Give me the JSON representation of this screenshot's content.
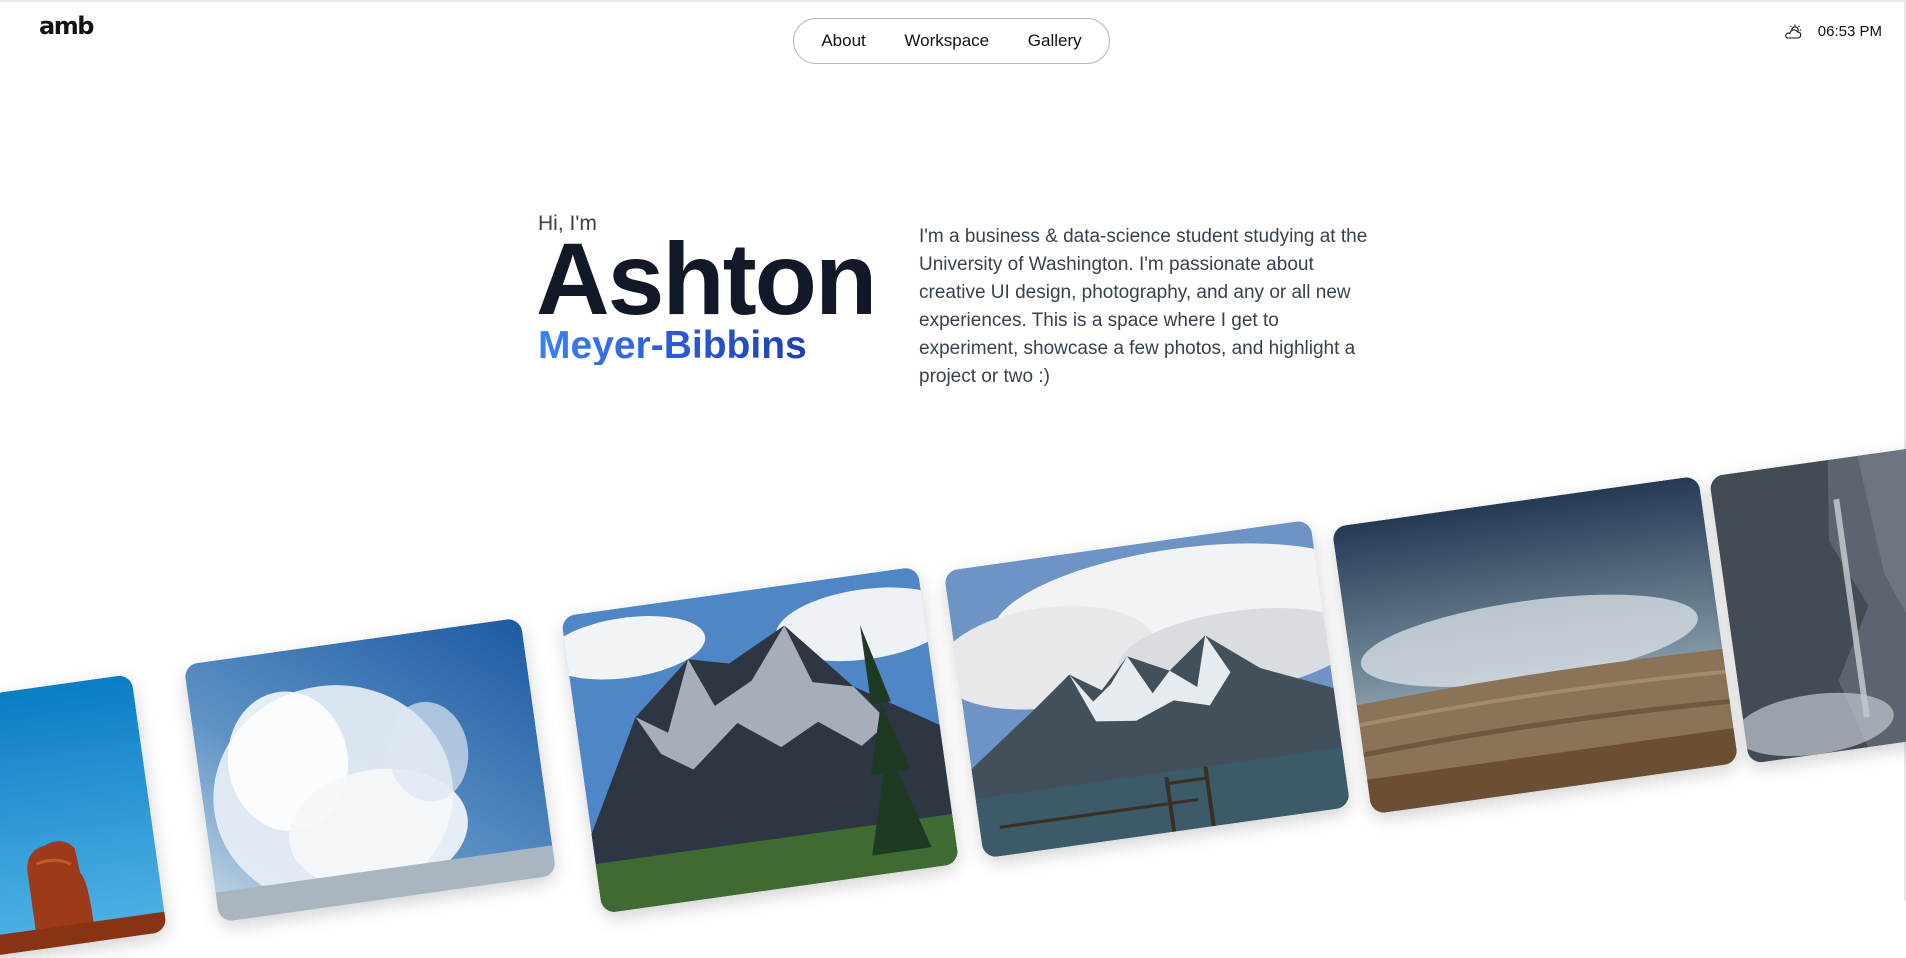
{
  "header": {
    "logo": "amb",
    "nav": [
      "About",
      "Workspace",
      "Gallery"
    ],
    "weather_icon": "partly-cloudy-sun-icon",
    "time": "06:53 PM"
  },
  "hero": {
    "greeting": "Hi, I'm",
    "first_name": "Ashton",
    "last_name": "Meyer-Bibbins",
    "bio": "I'm a business & data-science student studying at the University of Washington. I'm passionate about creative UI design, photography, and any or all new experiences. This is a space where I get to experiment, showcase a few photos, and highlight a project or two :)"
  },
  "gallery": {
    "photos": [
      {
        "subject": "red-rock-arch"
      },
      {
        "subject": "crashing-wave"
      },
      {
        "subject": "snowy-mountain-with-pine"
      },
      {
        "subject": "teton-peaks-with-fence"
      },
      {
        "subject": "stormy-hot-spring-basin"
      },
      {
        "subject": "rock-cliff-waterfall"
      }
    ]
  },
  "colors": {
    "name_gradient_start": "#3b82f6",
    "name_gradient_end": "#1e40af",
    "text_dark": "#111827",
    "text_body": "#374151"
  }
}
